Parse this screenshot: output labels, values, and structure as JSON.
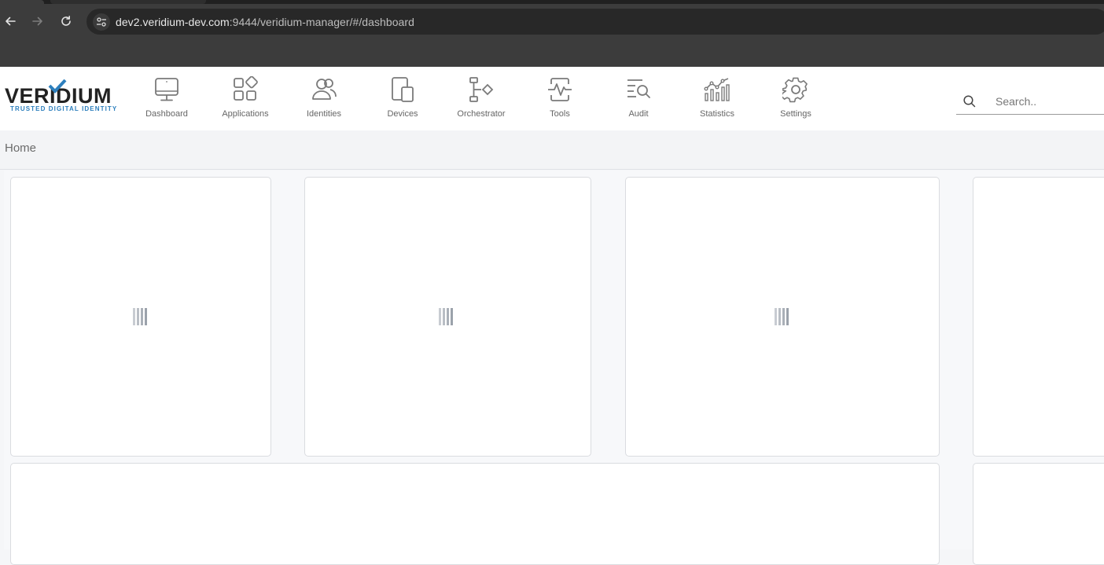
{
  "browser": {
    "url_host": "dev2.veridium-dev.com",
    "url_path": ":9444/veridium-manager/#/dashboard"
  },
  "logo": {
    "word": "VERIDIUM",
    "tagline": "TRUSTED DIGITAL IDENTITY"
  },
  "nav": {
    "items": [
      {
        "label": "Dashboard",
        "icon": "monitor-icon"
      },
      {
        "label": "Applications",
        "icon": "apps-grid-icon"
      },
      {
        "label": "Identities",
        "icon": "users-icon"
      },
      {
        "label": "Devices",
        "icon": "devices-icon"
      },
      {
        "label": "Orchestrator",
        "icon": "flow-icon"
      },
      {
        "label": "Tools",
        "icon": "pulse-icon"
      },
      {
        "label": "Audit",
        "icon": "audit-search-icon"
      },
      {
        "label": "Statistics",
        "icon": "stats-chart-icon"
      },
      {
        "label": "Settings",
        "icon": "gear-icon"
      }
    ]
  },
  "search": {
    "placeholder": "Search.."
  },
  "breadcrumb": {
    "home": "Home"
  },
  "colors": {
    "accent_blue": "#2d7fbd",
    "icon_gray": "#7a7a7a"
  }
}
